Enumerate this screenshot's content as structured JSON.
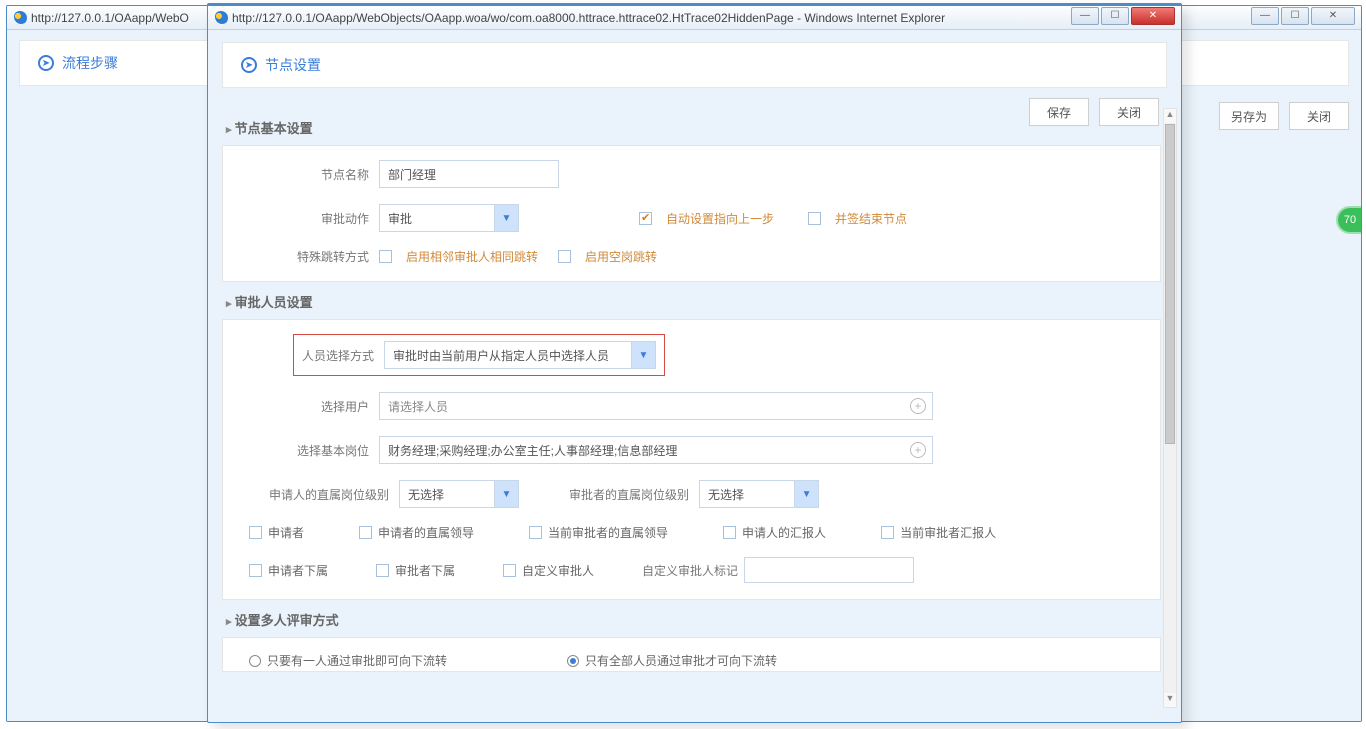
{
  "back_window": {
    "url": "http://127.0.0.1/OAapp/WebO",
    "title": "流程步骤",
    "toolbar": {
      "save_as": "另存为",
      "close": "关闭"
    }
  },
  "front_window": {
    "url": "http://127.0.0.1/OAapp/WebObjects/OAapp.woa/wo/com.oa8000.httrace.httrace02.HtTrace02HiddenPage - Windows Internet Explorer",
    "title": "节点设置",
    "toolbar": {
      "save": "保存",
      "close": "关闭"
    }
  },
  "badge": "70",
  "sections": {
    "basic": {
      "head": "节点基本设置",
      "node_name_lbl": "节点名称",
      "node_name_val": "部门经理",
      "action_lbl": "审批动作",
      "action_val": "审批",
      "auto_prev": "自动设置指向上一步",
      "end_node": "并签结束节点",
      "jump_lbl": "特殊跳转方式",
      "jump_same": "启用相邻审批人相同跳转",
      "jump_empty": "启用空岗跳转"
    },
    "approver": {
      "head": "审批人员设置",
      "select_mode_lbl": "人员选择方式",
      "select_mode_val": "审批时由当前用户从指定人员中选择人员",
      "select_user_lbl": "选择用户",
      "select_user_ph": "请选择人员",
      "select_post_lbl": "选择基本岗位",
      "select_post_val": "财务经理;采购经理;办公室主任;人事部经理;信息部经理",
      "req_post_lbl": "申请人的直属岗位级别",
      "req_post_val": "无选择",
      "apr_post_lbl": "审批者的直属岗位级别",
      "apr_post_val": "无选择",
      "cbx": {
        "c1": "申请者",
        "c2": "申请者的直属领导",
        "c3": "当前审批者的直属领导",
        "c4": "申请人的汇报人",
        "c5": "当前审批者汇报人",
        "c6": "申请者下属",
        "c7": "审批者下属",
        "c8": "自定义审批人"
      },
      "custom_tag_lbl": "自定义审批人标记"
    },
    "multi": {
      "head": "设置多人评审方式",
      "r1": "只要有一人通过审批即可向下流转",
      "r2": "只有全部人员通过审批才可向下流转"
    }
  }
}
